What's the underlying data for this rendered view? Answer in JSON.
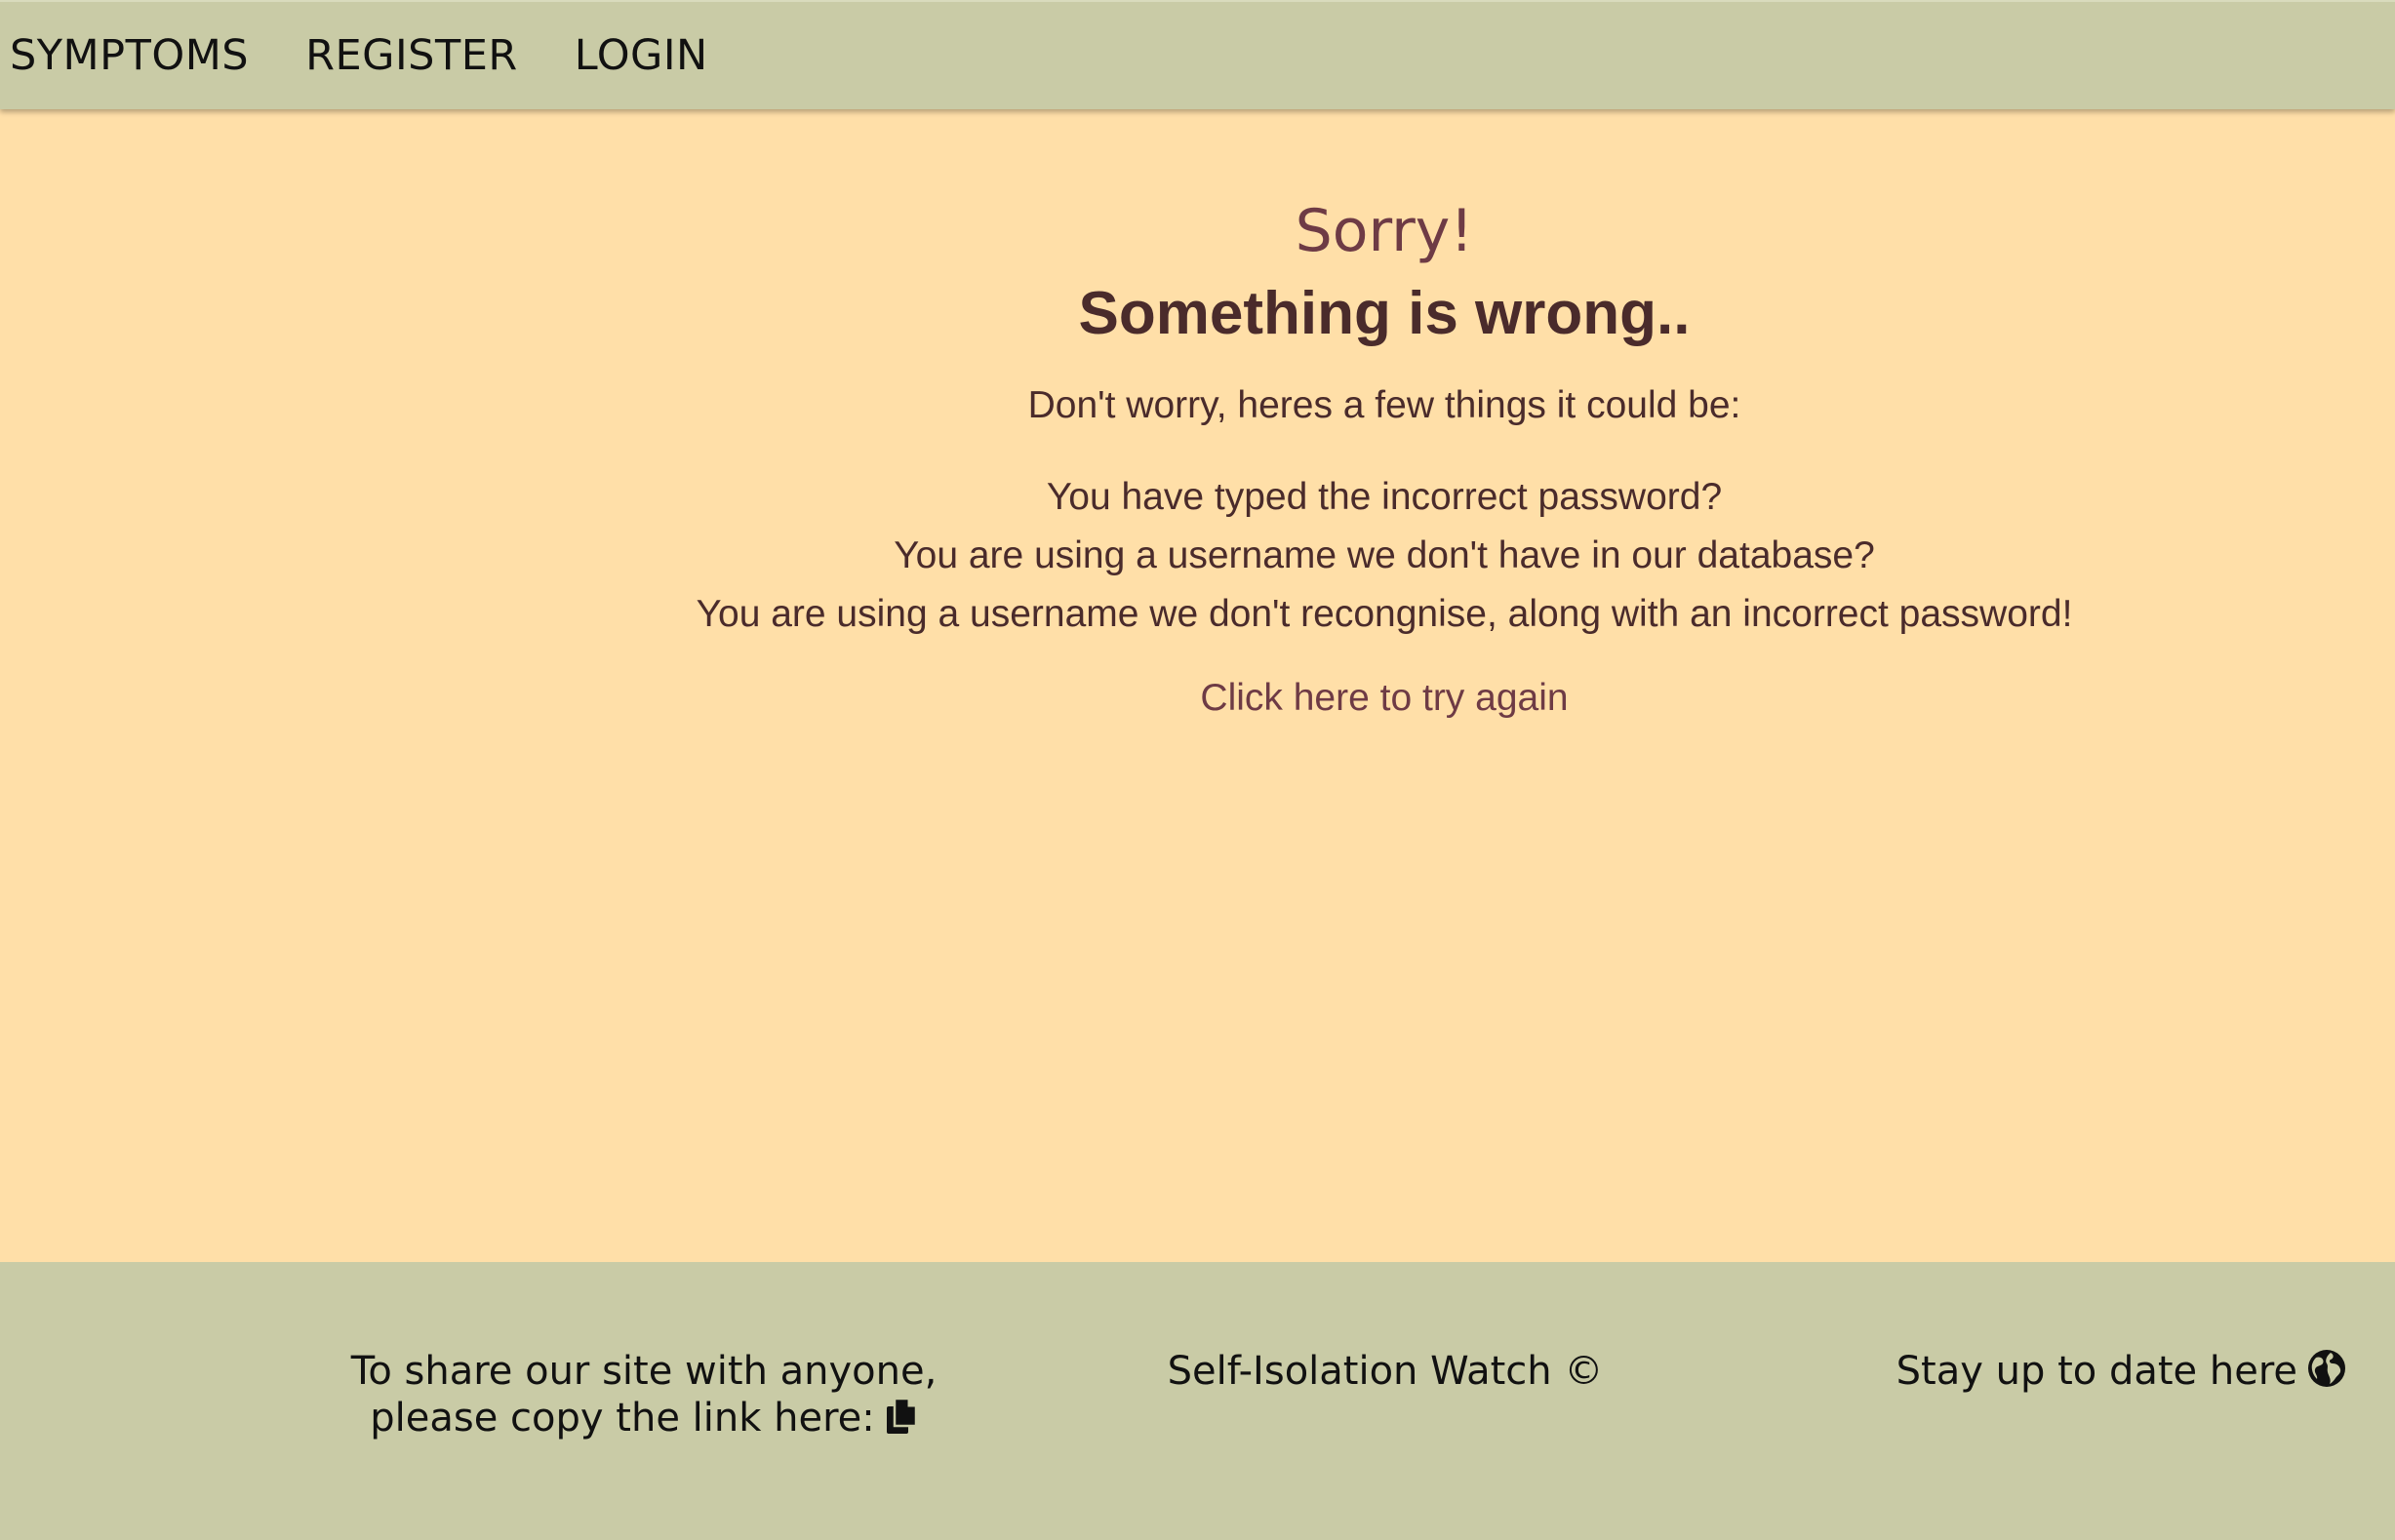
{
  "nav": {
    "items": [
      {
        "label": "SYMPTOMS"
      },
      {
        "label": "REGISTER"
      },
      {
        "label": "LOGIN"
      }
    ]
  },
  "error": {
    "heading": "Sorry!",
    "subheading": "Something is wrong..",
    "intro": "Don't worry, heres a few things it could be:",
    "reasons": [
      "You have typed the incorrect password?",
      "You are using a username we don't have in our database?",
      "You are using a username we don't recongnise, along with an incorrect password!"
    ],
    "retry_link": "Click here to try again"
  },
  "footer": {
    "share_text": "To share our site with anyone, please copy the link here:",
    "share_icon": "copy-icon",
    "brand": "Self-Isolation Watch ©",
    "stay_text": "Stay up to date here",
    "stay_icon": "globe-icon"
  },
  "colors": {
    "page_background": "#ffdfa8",
    "bar_background": "#c9cba6",
    "heading_color": "#6e3b45",
    "text_color": "#4a2b2b"
  }
}
